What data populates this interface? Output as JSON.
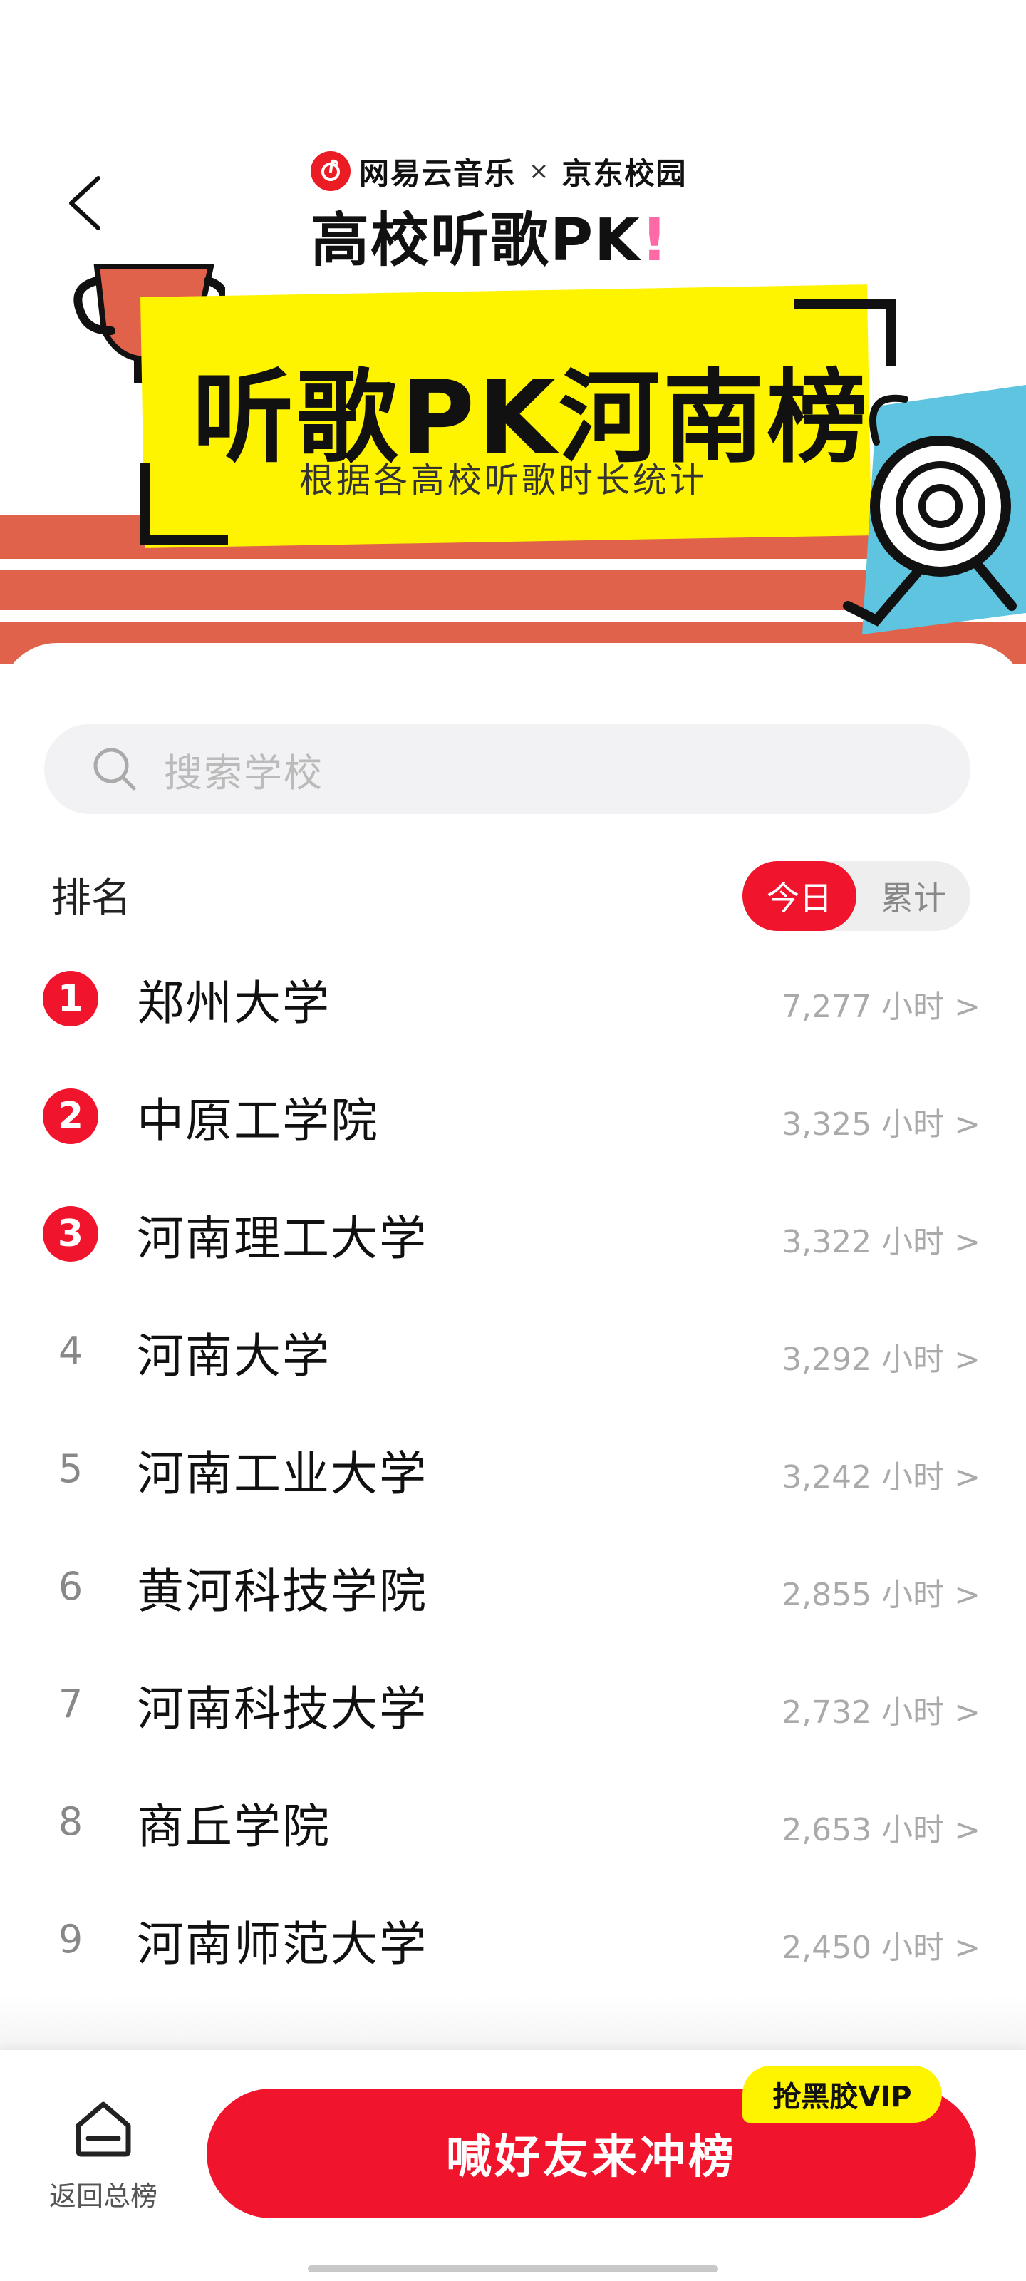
{
  "header": {
    "brand_left": "网易云音乐",
    "brand_x": "×",
    "brand_right": "京东校园",
    "headline": "高校听歌PK",
    "headline_bang": "!"
  },
  "board": {
    "title": "听歌PK河南榜",
    "subtitle": "根据各高校听歌时长统计"
  },
  "search": {
    "placeholder": "搜索学校"
  },
  "ranking": {
    "label": "排名",
    "tabs": [
      "今日",
      "累计"
    ],
    "selected_tab": "今日",
    "accent": "#f0142c",
    "items": [
      {
        "rank": "1",
        "school": "郑州大学",
        "hours": "7,277 小时 >"
      },
      {
        "rank": "2",
        "school": "中原工学院",
        "hours": "3,325 小时 >"
      },
      {
        "rank": "3",
        "school": "河南理工大学",
        "hours": "3,322 小时 >"
      },
      {
        "rank": "4",
        "school": "河南大学",
        "hours": "3,292 小时 >"
      },
      {
        "rank": "5",
        "school": "河南工业大学",
        "hours": "3,242 小时 >"
      },
      {
        "rank": "6",
        "school": "黄河科技学院",
        "hours": "2,855 小时 >"
      },
      {
        "rank": "7",
        "school": "河南科技大学",
        "hours": "2,732 小时 >"
      },
      {
        "rank": "8",
        "school": "商丘学院",
        "hours": "2,653 小时 >"
      },
      {
        "rank": "9",
        "school": "河南师范大学",
        "hours": "2,450 小时 >"
      }
    ]
  },
  "bottom": {
    "home_label": "返回总榜",
    "cta_label": "喊好友来冲榜",
    "vip_badge": "抢黑胶VIP"
  },
  "icons": {
    "back": "chevron-left-icon",
    "logo": "netease-logo-icon",
    "search": "search-icon",
    "home": "home-icon"
  }
}
